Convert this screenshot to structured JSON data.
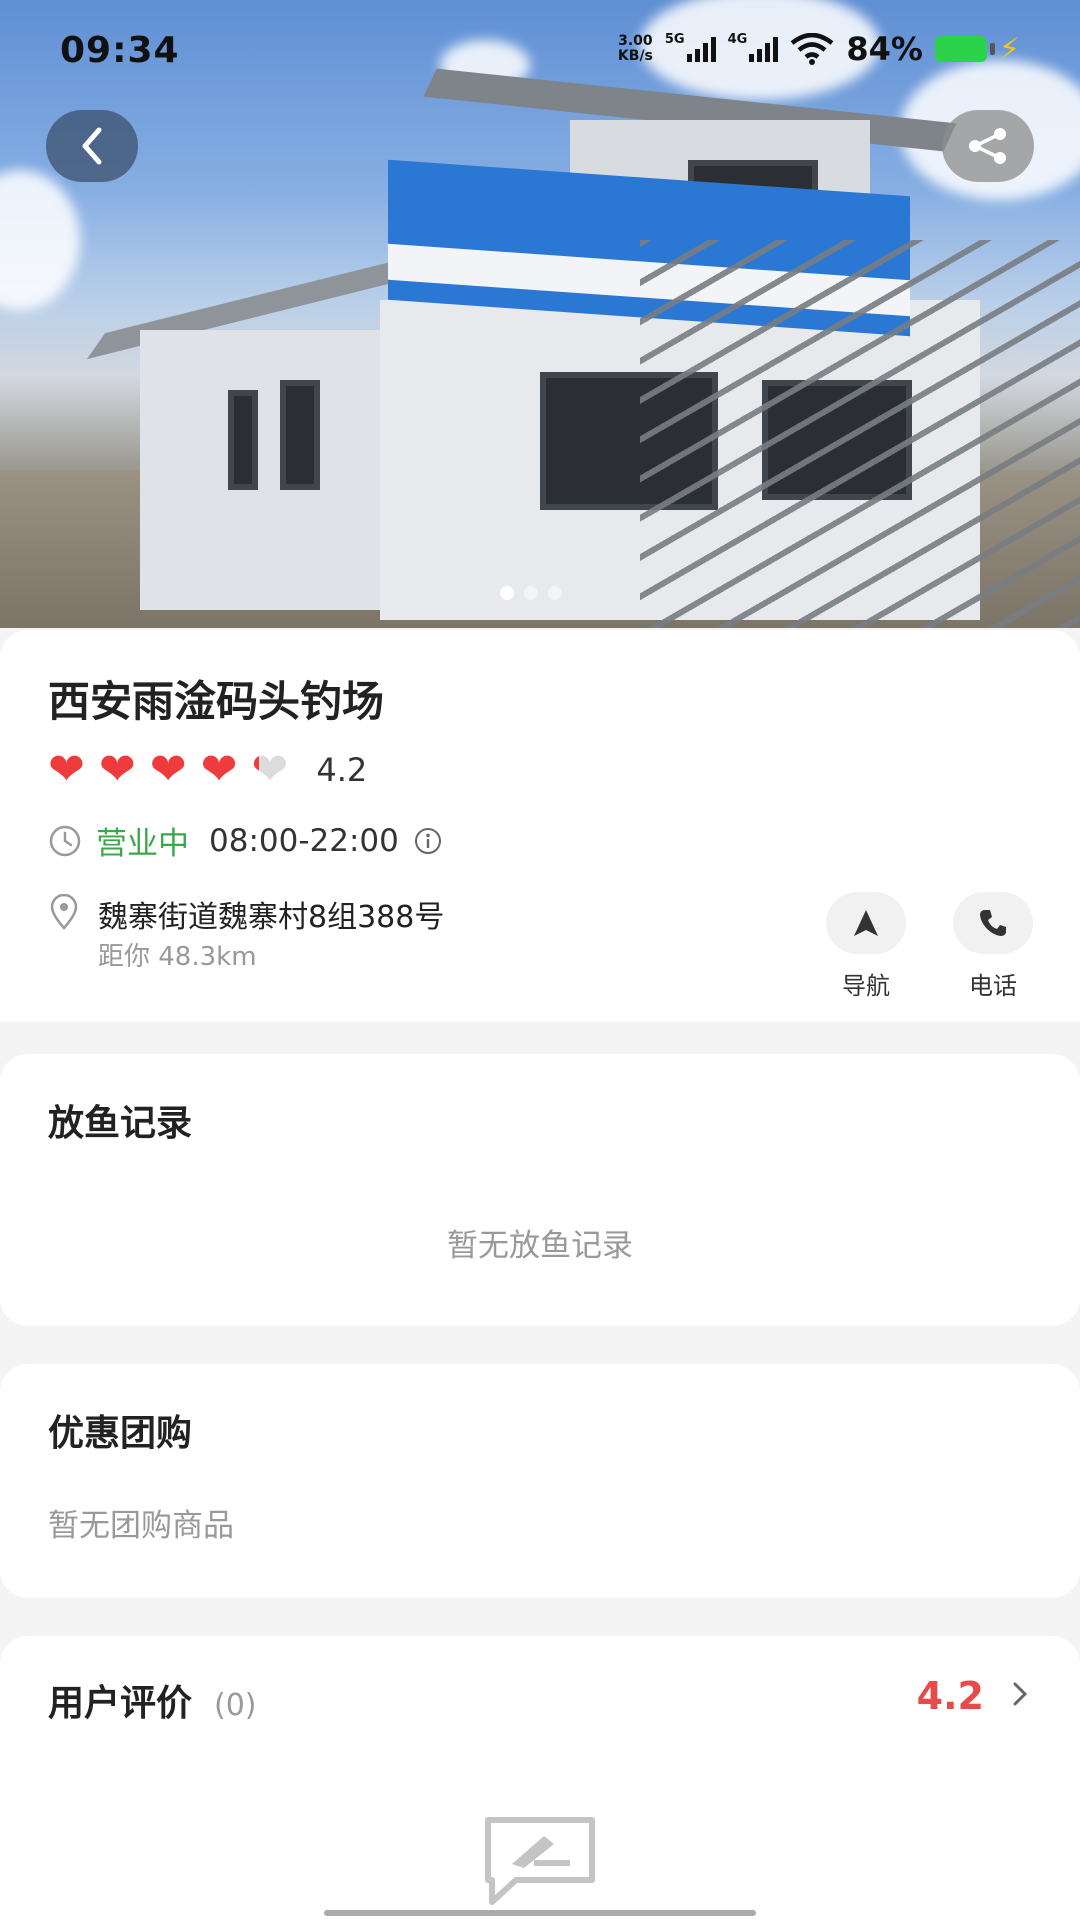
{
  "status_bar": {
    "time": "09:34",
    "speed_value": "3.00",
    "speed_unit": "KB/s",
    "net1": "5G",
    "net2": "4G",
    "battery": "84%",
    "battery_color": "#2bd34a"
  },
  "hero": {
    "image": "fishing-ground-building-photo",
    "slides": 3,
    "active_slide": 1
  },
  "venue": {
    "name": "西安雨淦码头钓场",
    "rating": "4.2",
    "rating_value": 4.2,
    "status": "营业中",
    "hours": "08:00-22:00",
    "address": "魏寨街道魏寨村8组388号",
    "distance": "距你 48.3km"
  },
  "actions": {
    "navigate": "导航",
    "call": "电话"
  },
  "release_records": {
    "title": "放鱼记录",
    "empty": "暂无放鱼记录"
  },
  "group_buy": {
    "title": "优惠团购",
    "empty": "暂无团购商品"
  },
  "reviews": {
    "title": "用户评价",
    "count": "(0)",
    "score": "4.2"
  },
  "colors": {
    "accent_red": "#e84a4a",
    "heart_red": "#ef3b3b",
    "open_green": "#3aa84a"
  }
}
